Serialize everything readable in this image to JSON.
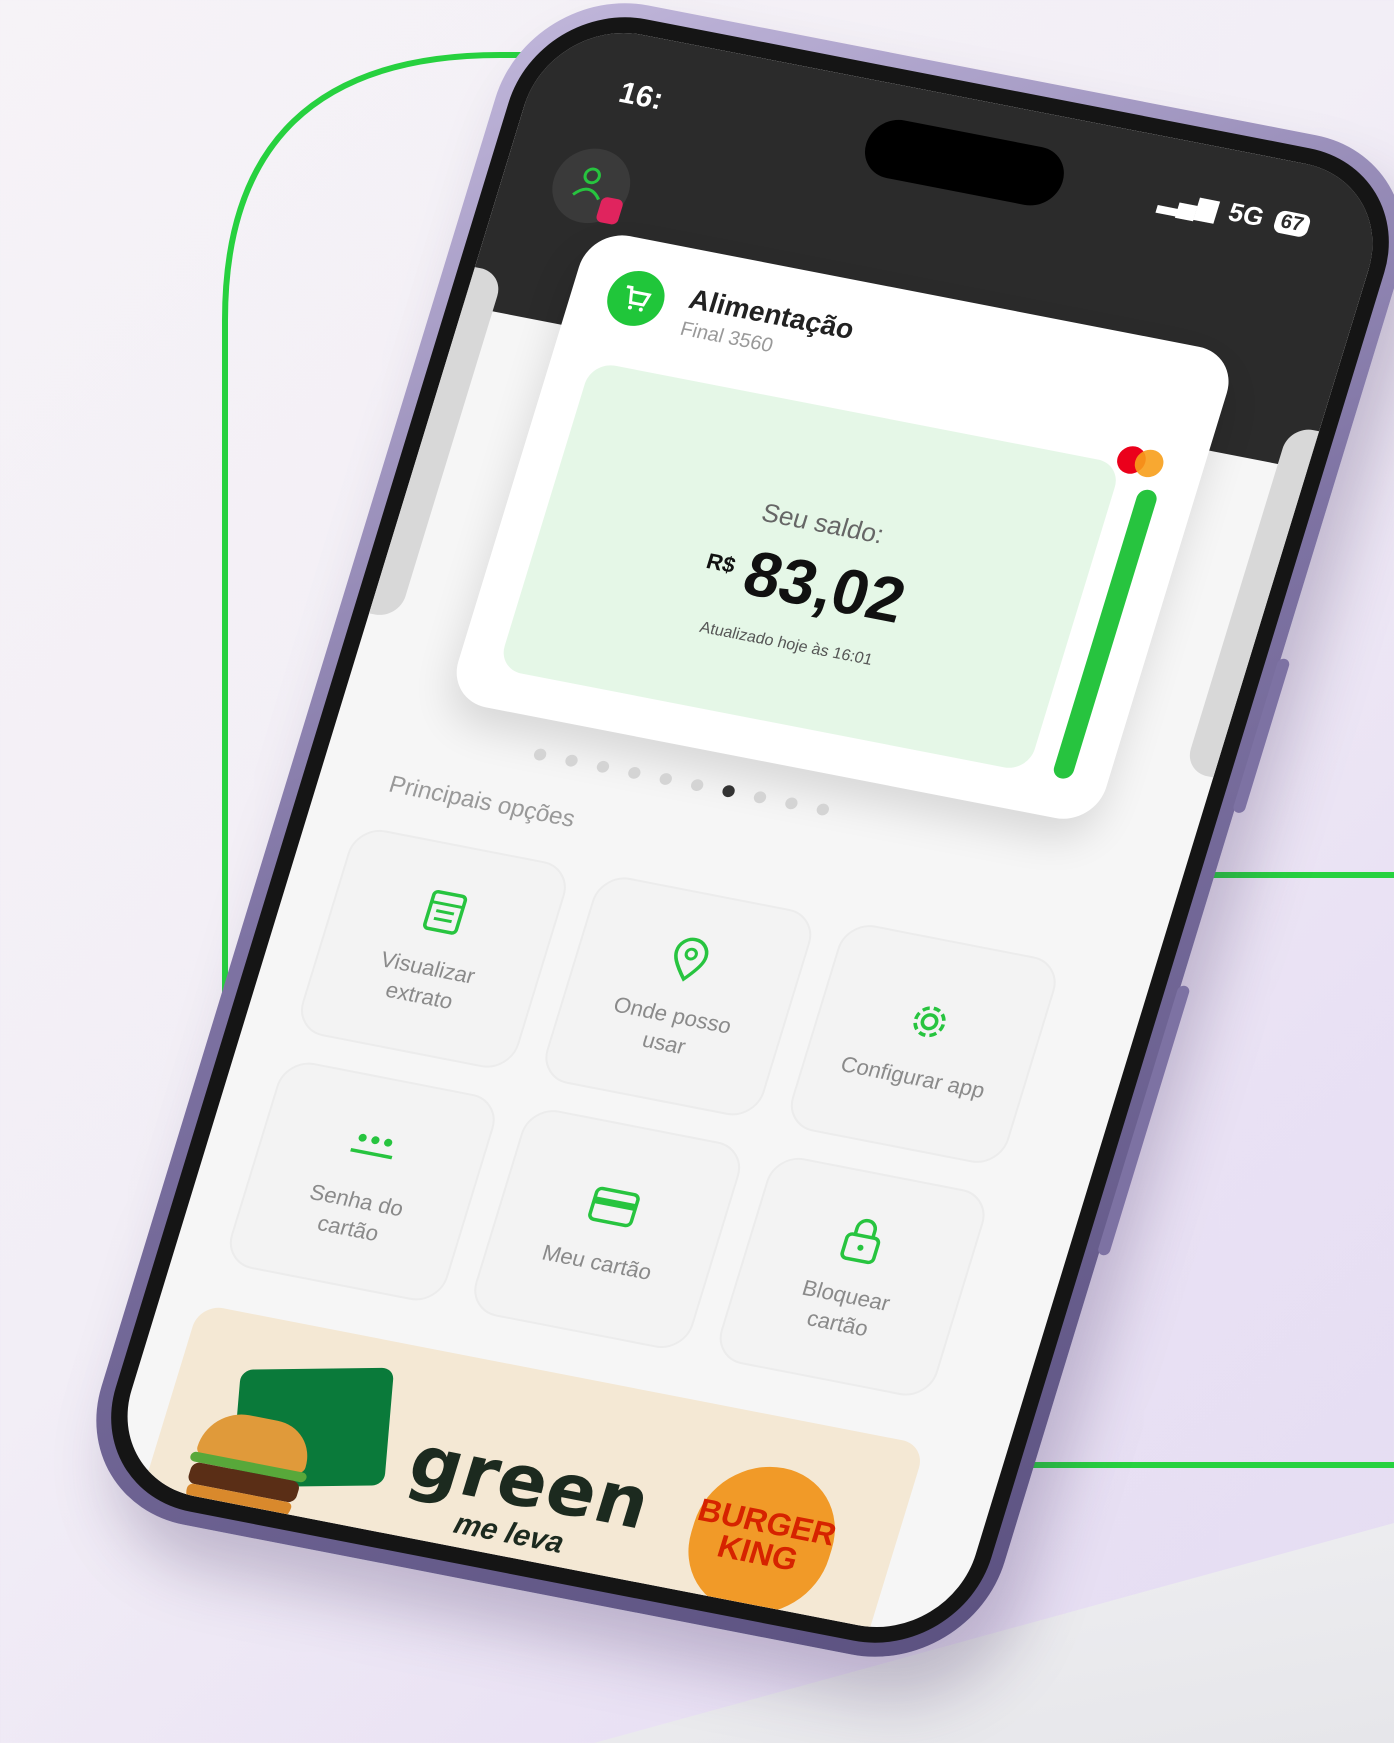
{
  "colors": {
    "accent": "#27c43f",
    "dark_header": "#2b2b2b",
    "balance_panel": "#e5f7e7",
    "badge": "#e0245e",
    "banner_bg": "#f4e8d4"
  },
  "status_bar": {
    "time": "16:",
    "signal": "5G",
    "battery": "67"
  },
  "header": {
    "avatar_icon": "user-icon"
  },
  "card": {
    "icon": "cart-icon",
    "title": "Alimentação",
    "subtitle": "Final 3560",
    "brand_icon": "mastercard-icon",
    "balance_label": "Seu saldo:",
    "currency": "R$",
    "balance": "83,02",
    "updated": "Atualizado hoje às 16:01"
  },
  "carousel": {
    "count": 10,
    "active_index": 6
  },
  "options": {
    "title": "Principais opções",
    "tiles": [
      {
        "label": "Visualizar extrato",
        "icon": "receipt-icon"
      },
      {
        "label": "Onde posso usar",
        "icon": "map-pin-icon"
      },
      {
        "label": "Configurar app",
        "icon": "gear-icon"
      },
      {
        "label": "Senha do cartão",
        "icon": "password-icon"
      },
      {
        "label": "Meu cartão",
        "icon": "credit-card-icon"
      },
      {
        "label": "Bloquear cartão",
        "icon": "lock-icon"
      }
    ]
  },
  "banner": {
    "brand": "green",
    "tagline": "me leva",
    "partner": "BURGER KING"
  }
}
